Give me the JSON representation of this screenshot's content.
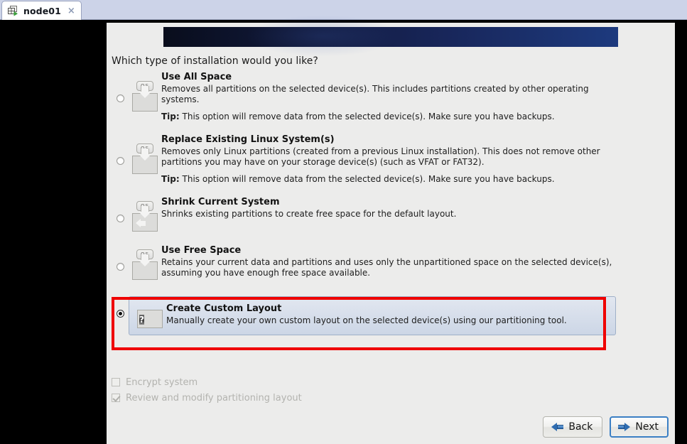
{
  "tab": {
    "label": "node01",
    "close_label": "×",
    "icon": "virtual-machine-icon"
  },
  "installer": {
    "question": "Which type of installation would you like?",
    "options": [
      {
        "id": "use-all-space",
        "title": "Use All Space",
        "description": "Removes all partitions on the selected device(s).  This includes partitions created by other operating systems.",
        "tip_label": "Tip:",
        "tip": "This option will remove data from the selected device(s).  Make sure you have backups.",
        "selected": false,
        "icon": "disk-use-all-space-icon"
      },
      {
        "id": "replace-existing-linux",
        "title": "Replace Existing Linux System(s)",
        "description": "Removes only Linux partitions (created from a previous Linux installation).  This does not remove other partitions you may have on your storage device(s) (such as VFAT or FAT32).",
        "tip_label": "Tip:",
        "tip": "This option will remove data from the selected device(s).  Make sure you have backups.",
        "selected": false,
        "icon": "disk-replace-linux-icon"
      },
      {
        "id": "shrink-current-system",
        "title": "Shrink Current System",
        "description": "Shrinks existing partitions to create free space for the default layout.",
        "tip_label": "",
        "tip": "",
        "selected": false,
        "icon": "disk-shrink-icon"
      },
      {
        "id": "use-free-space",
        "title": "Use Free Space",
        "description": "Retains your current data and partitions and uses only the unpartitioned space on the selected device(s), assuming you have enough free space available.",
        "tip_label": "",
        "tip": "",
        "selected": false,
        "icon": "disk-free-space-icon"
      },
      {
        "id": "create-custom-layout",
        "title": "Create Custom Layout",
        "description": "Manually create your own custom layout on the selected device(s) using our partitioning tool.",
        "tip_label": "",
        "tip": "",
        "selected": true,
        "icon": "question-mark-icon"
      }
    ],
    "os_chip_label": "OS",
    "question_mark": "?",
    "checkboxes": [
      {
        "id": "encrypt-system",
        "label": "Encrypt system",
        "checked": false,
        "disabled": true
      },
      {
        "id": "review-modify-partitioning",
        "label": "Review and modify partitioning layout",
        "checked": true,
        "disabled": true
      }
    ],
    "buttons": {
      "back": "Back",
      "next": "Next"
    }
  },
  "annotation": {
    "color": "#ef0000",
    "target": "create-custom-layout"
  },
  "colors": {
    "banner_start": "#090d1c",
    "banner_end": "#1d3a7e",
    "panel_bg": "#ececeb",
    "selected_row": "#ccd6e6",
    "accent_blue": "#2f6cb0",
    "annotation_red": "#ef0000",
    "tabbar_bg": "#ccd3e8"
  }
}
